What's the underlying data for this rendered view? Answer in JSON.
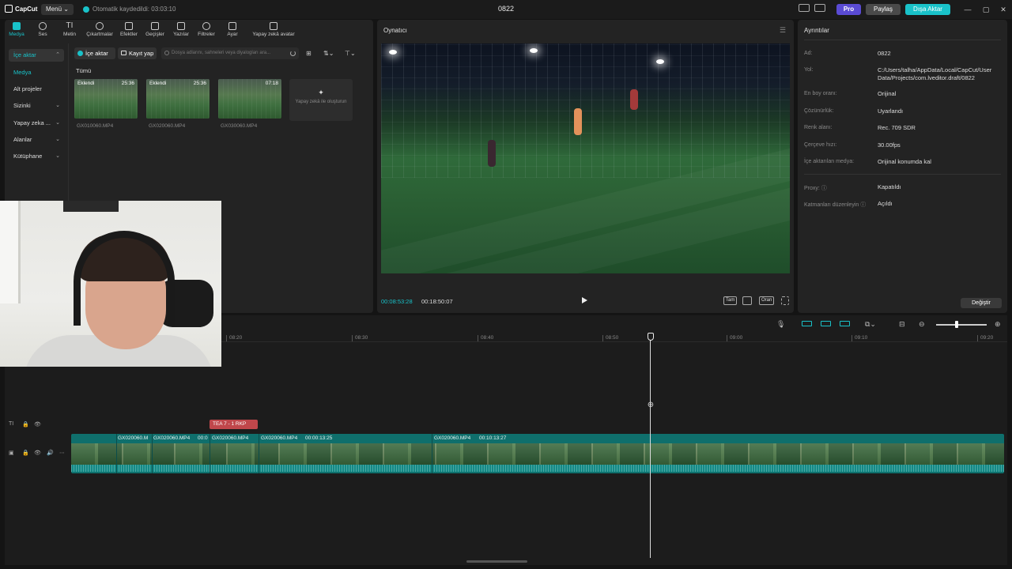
{
  "app": {
    "logo_text": "CapCut",
    "menu_label": "Menü",
    "autosave_text": "Otomatik kaydedildi: 03:03:10",
    "project_title": "0822",
    "pro_label": "Pro",
    "share_label": "Paylaş",
    "export_label": "Dışa Aktar"
  },
  "toolbar": {
    "tabs": [
      {
        "label": "Medya",
        "icon": "media-icon"
      },
      {
        "label": "Ses",
        "icon": "audio-icon"
      },
      {
        "label": "Metin",
        "icon": "text-icon"
      },
      {
        "label": "Çıkartmalar",
        "icon": "sticker-icon"
      },
      {
        "label": "Efektler",
        "icon": "effects-icon"
      },
      {
        "label": "Geçişler",
        "icon": "transitions-icon"
      },
      {
        "label": "Yazılar",
        "icon": "captions-icon"
      },
      {
        "label": "Filtreler",
        "icon": "filters-icon"
      },
      {
        "label": "Ayar",
        "icon": "adjust-icon"
      },
      {
        "label": "Yapay zekâ avatar",
        "icon": "ai-avatar-icon"
      }
    ]
  },
  "sidebar": {
    "items": [
      {
        "label": "İçe aktar"
      },
      {
        "label": "Medya"
      },
      {
        "label": "Alt projeler"
      },
      {
        "label": "Sizinki"
      },
      {
        "label": "Yapay zeka ..."
      },
      {
        "label": "Alanlar"
      },
      {
        "label": "Kütüphane"
      }
    ]
  },
  "media": {
    "import_label": "İçe aktar",
    "record_label": "Kayıt yap",
    "search_placeholder": "Dosya adlarını, sahneleri veya diyalogları ara...",
    "section_title": "Tümü",
    "clips": [
      {
        "badge": "Eklendi",
        "duration": "25:36",
        "name": "GX010060.MP4"
      },
      {
        "badge": "Eklendi",
        "duration": "25:36",
        "name": "GX020060.MP4"
      },
      {
        "badge": "",
        "duration": "07:18",
        "name": "GX030060.MP4"
      }
    ],
    "ai_card_label": "Yapay zekâ ile oluşturun"
  },
  "player": {
    "title": "Oynatıcı",
    "current_time": "00:08:53:28",
    "total_time": "00:18:50:07",
    "full_label": "Tam",
    "ratio_label": "Oran"
  },
  "details": {
    "title": "Ayrıntılar",
    "rows": [
      {
        "label": "Ad:",
        "value": "0822"
      },
      {
        "label": "Yol:",
        "value": "C:/Users/talha/AppData/Local/CapCut/User Data/Projects/com.lveditor.draft/0822"
      },
      {
        "label": "En boy oranı:",
        "value": "Orijinal"
      },
      {
        "label": "Çözünürlük:",
        "value": "Uyarlandı"
      },
      {
        "label": "Renk alanı:",
        "value": "Rec. 709 SDR"
      },
      {
        "label": "Çerçeve hızı:",
        "value": "30.00fps"
      },
      {
        "label": "İçe aktarılan medya:",
        "value": "Orijinal konumda kal"
      },
      {
        "label": "Proxy:",
        "value": "Kapatıldı"
      },
      {
        "label": "Katmanları düzenleyin",
        "value": "Açıldı"
      }
    ],
    "change_label": "Değiştir"
  },
  "timeline": {
    "ruler_ticks": [
      "08:20",
      "08:30",
      "08:40",
      "08:50",
      "09:00",
      "09:10",
      "09:20"
    ],
    "text_clip_label": "TEA 7 - 1 RKP",
    "clip_labels": [
      "GX020060.M",
      "GX020060.MP4",
      "00:0",
      "GX020060.MP4",
      "GX020060.MP4",
      "00:00:13:25",
      "GX020060.MP4",
      "00:10:13:27"
    ]
  }
}
